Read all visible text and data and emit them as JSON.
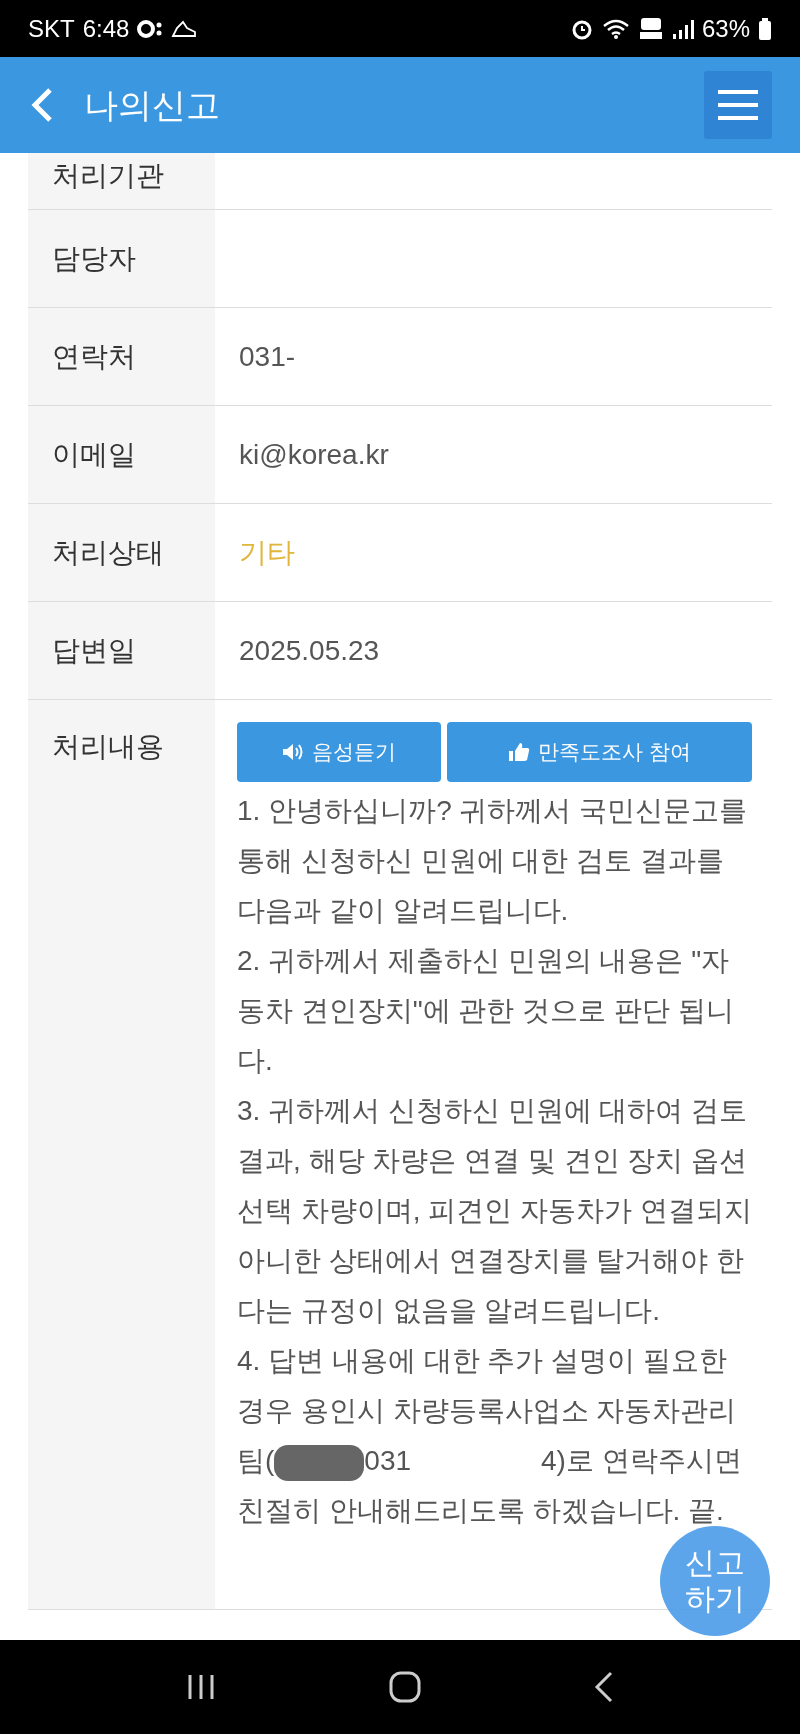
{
  "status_bar": {
    "carrier": "SKT",
    "time": "6:48",
    "battery": "63%"
  },
  "header": {
    "title": "나의신고"
  },
  "details": [
    {
      "label": "처리기관"
    },
    {
      "label": "담당자"
    },
    {
      "label": "연락처",
      "value": "031-"
    },
    {
      "label": "이메일",
      "value": "ki@korea.kr"
    },
    {
      "label": "처리상태",
      "value": "기타",
      "kind": "status",
      "color": "#e0b53a"
    },
    {
      "label": "답변일",
      "value": "2025.05.23"
    }
  ],
  "response": {
    "label": "처리내용",
    "buttons": [
      {
        "label": "음성듣기",
        "kind": "listen"
      },
      {
        "label": "만족도조사 참여",
        "kind": "survey"
      }
    ],
    "paragraphs": [
      "1. 안녕하십니까? 귀하께서 국민신문고를 통해 신청하신 민원에 대한 검토 결과를 다음과 같이 알려드립니다.",
      "2. 귀하께서 제출하신 민원의 내용은 \"자동차 견인장치\"에 관한 것으로 판단 됩니다.",
      "3. 귀하께서 신청하신 민원에 대하여 검토결과, 해당 차량은 연결 및 견인 장치 옵션 선택 차량이며, 피견인 자동차가 연결되지 아니한 상태에서 연결장치를 탈거해야 한다는 규정이 없음을 알려드립니다."
    ],
    "last_paragraph": {
      "before": "4. 답변 내용에 대한 추가 설명이 필요한 경우 용인시 차량등록사업소 자동차관리팀(",
      "middle": "031",
      "after": "4)로 연락주시면 친절히 안내해드리도록 하겠습니다. 끝."
    }
  },
  "fab": {
    "line_1": "신고",
    "line_2": "하기"
  }
}
